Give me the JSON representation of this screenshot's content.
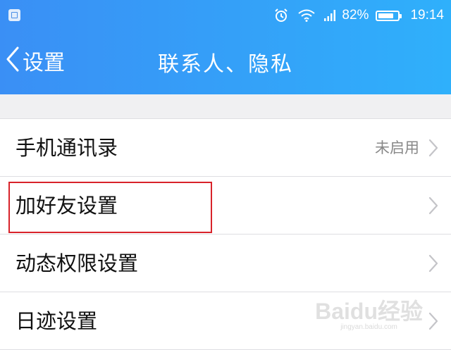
{
  "status_bar": {
    "battery_percent": "82%",
    "battery_level": 0.82,
    "time": "19:14",
    "icons": [
      "screenshot-icon",
      "alarm-icon",
      "wifi-icon",
      "signal-icon",
      "battery-icon"
    ]
  },
  "nav": {
    "back_label": "设置",
    "title": "联系人、隐私"
  },
  "rows": [
    {
      "label": "手机通讯录",
      "value": "未启用"
    },
    {
      "label": "加好友设置",
      "value": ""
    },
    {
      "label": "动态权限设置",
      "value": ""
    },
    {
      "label": "日迹设置",
      "value": ""
    }
  ],
  "watermark": {
    "logo": "Baidu经验",
    "sub": "jingyan.baidu.com"
  },
  "colors": {
    "header_start": "#3a8ff5",
    "header_end": "#2fb0fb",
    "highlight": "#d8232a"
  }
}
